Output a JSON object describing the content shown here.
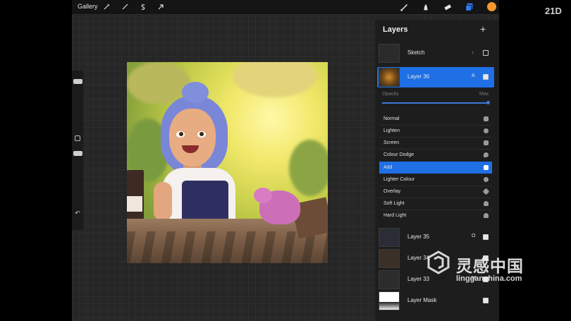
{
  "toolbar": {
    "gallery_label": "Gallery",
    "left_icons": [
      "wrench-icon",
      "magic-wand-icon",
      "selection-icon",
      "transform-arrow-icon"
    ],
    "right_icons": [
      "brush-icon",
      "smudge-icon",
      "eraser-icon",
      "layers-icon"
    ],
    "active_color": "#f5972f"
  },
  "layers_panel": {
    "title": "Layers",
    "add_symbol": "+",
    "layers_top": [
      {
        "name": "Sketch",
        "mode": "",
        "visible": false,
        "active": false
      },
      {
        "name": "Layer 36",
        "mode": "A",
        "visible": true,
        "active": true
      }
    ],
    "opacity": {
      "label": "Opacity",
      "max_label": "Max",
      "value": 1.0
    },
    "blend_modes": [
      {
        "label": "Normal",
        "selected": false
      },
      {
        "label": "Lighten",
        "selected": false
      },
      {
        "label": "Screen",
        "selected": false
      },
      {
        "label": "Colour Dodge",
        "selected": false
      },
      {
        "label": "Add",
        "selected": true
      },
      {
        "label": "Lighter Colour",
        "selected": false
      },
      {
        "label": "Overlay",
        "selected": false
      },
      {
        "label": "Soft Light",
        "selected": false
      },
      {
        "label": "Hard Light",
        "selected": false
      }
    ],
    "layers_bottom": [
      {
        "name": "Layer 35",
        "mode": "O",
        "visible": true
      },
      {
        "name": "Layer 34",
        "mode": "",
        "visible": true
      },
      {
        "name": "Layer 33",
        "mode": "M",
        "visible": true
      },
      {
        "name": "Layer Mask",
        "mode": "",
        "visible": true
      }
    ]
  },
  "watermarks": {
    "corner": "21D",
    "brand_cn": "灵感中国",
    "brand_url": "lingganchina.com"
  },
  "colors": {
    "accent": "#1f6fe5",
    "panel_bg": "#1d1d1d",
    "canvas_bg": "#262626"
  }
}
